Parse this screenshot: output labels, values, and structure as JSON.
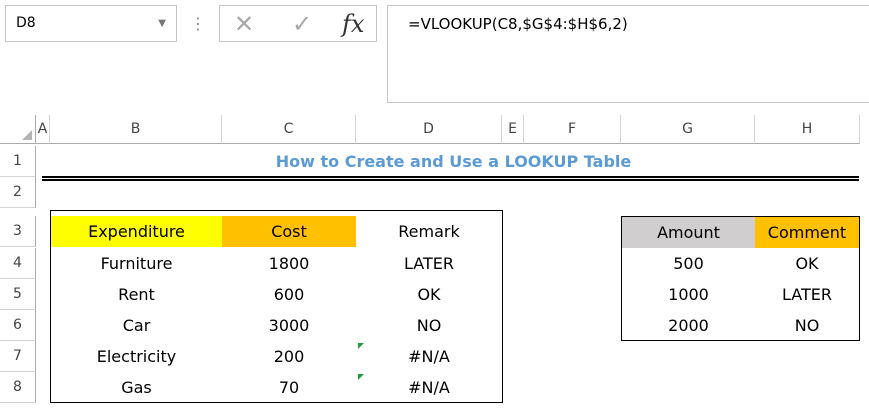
{
  "formula_bar": {
    "name_box": "D8",
    "formula": "=VLOOKUP(C8,$G$4:$H$6,2)",
    "cancel_symbol": "✕",
    "enter_symbol": "✓",
    "fx_symbol": "fx"
  },
  "columns": [
    "A",
    "B",
    "C",
    "D",
    "E",
    "F",
    "G",
    "H"
  ],
  "rows": [
    "1",
    "2",
    "3",
    "4",
    "5",
    "6",
    "7",
    "8"
  ],
  "title": "How to Create and Use a LOOKUP Table",
  "main_table": {
    "headers": [
      "Expenditure",
      "Cost",
      "Remark"
    ],
    "rows": [
      [
        "Furniture",
        "1800",
        "LATER"
      ],
      [
        "Rent",
        "600",
        "OK"
      ],
      [
        "Car",
        "3000",
        "NO"
      ],
      [
        "Electricity",
        "200",
        "#N/A"
      ],
      [
        "Gas",
        "70",
        "#N/A"
      ]
    ]
  },
  "lookup_table": {
    "headers": [
      "Amount",
      "Comment"
    ],
    "rows": [
      [
        "500",
        "OK"
      ],
      [
        "1000",
        "LATER"
      ],
      [
        "2000",
        "NO"
      ]
    ]
  },
  "colors": {
    "title": "#5b9bd5",
    "expenditure_header": "#ffff00",
    "cost_header": "#ffc000",
    "amount_header": "#d0cece",
    "comment_header": "#ffc000",
    "error_indicator": "#1f9c3f"
  }
}
